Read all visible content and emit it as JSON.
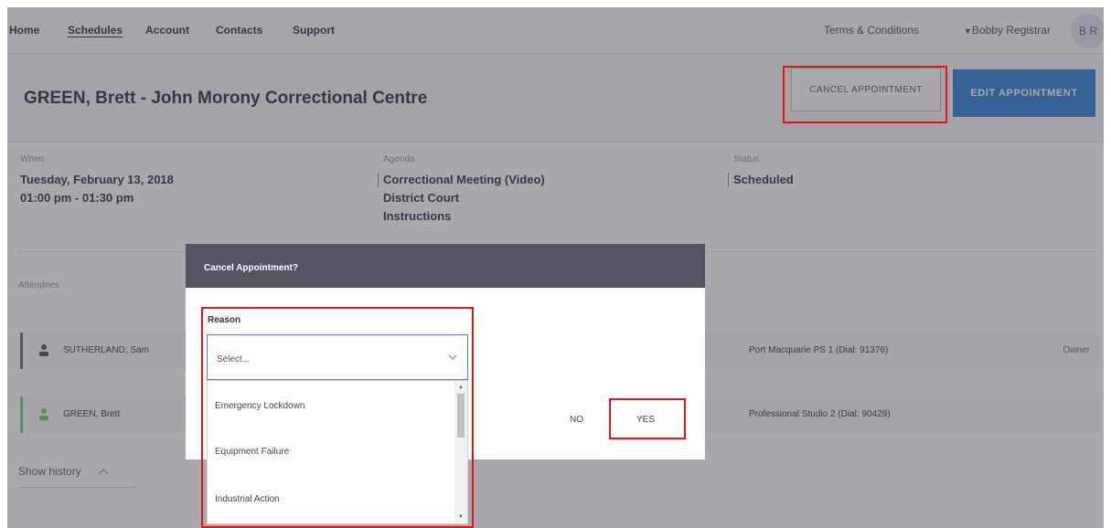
{
  "nav": {
    "items": [
      "Home",
      "Schedules",
      "Account",
      "Contacts",
      "Support"
    ],
    "terms": "Terms & Conditions",
    "user": "Bobby Registrar",
    "initials": "B R"
  },
  "header": {
    "title": "GREEN, Brett - John Morony Correctional Centre",
    "cancel_button": "CANCEL APPOINTMENT",
    "edit_button": "EDIT APPOINTMENT"
  },
  "details": {
    "when_label": "When",
    "when_date": "Tuesday, February 13, 2018",
    "when_time": "01:00 pm - 01:30 pm",
    "agenda_label": "Agenda",
    "agenda_lines": [
      "Correctional Meeting (Video)",
      "District Court",
      "Instructions"
    ],
    "status_label": "Status",
    "status_value": "Scheduled"
  },
  "attendees": {
    "label": "Attendees",
    "rows": [
      {
        "name": "SUTHERLAND, Sam",
        "room": "Port Macquarie PS 1 (Dial: 91376)",
        "role": "Owner"
      },
      {
        "name": "GREEN, Brett",
        "room": "Professional Studio 2 (Dial: 90429)",
        "role": ""
      }
    ]
  },
  "history": {
    "label": "Show history"
  },
  "modal": {
    "title": "Cancel Appointment?",
    "reason_label": "Reason",
    "select_value": "Select...",
    "no_label": "NO",
    "yes_label": "YES"
  },
  "dropdown": {
    "options": [
      "Emergency Lockdown",
      "Equipment Failure",
      "Industrial Action"
    ]
  },
  "colors": {
    "accent": "#2a7ad0",
    "highlight": "#e3141c",
    "modal_header": "#535362",
    "attendee_green": "#6fcf6c"
  }
}
